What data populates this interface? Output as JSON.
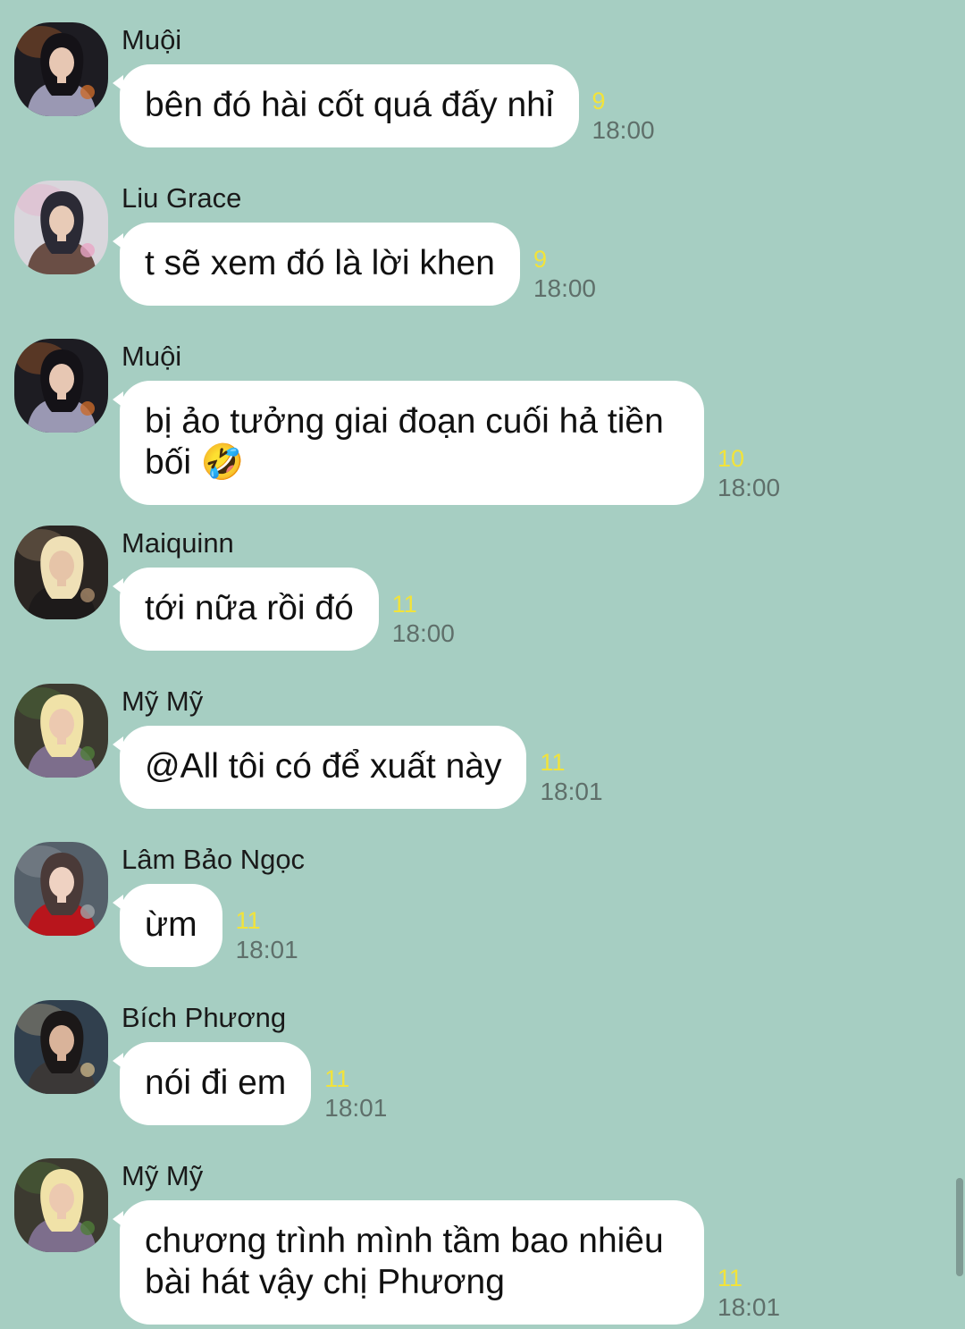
{
  "messages": [
    {
      "sender": "Muội",
      "text": "bên đó hài cốt quá đấy nhỉ",
      "read_count": "9",
      "time": "18:00",
      "avatar": {
        "icon": "avatar-muoii",
        "bg": "#1d1c22",
        "skin": "#e7c7b3",
        "hair": "#141217",
        "cloth": "#9a98b3",
        "accent": "#c96a2b"
      }
    },
    {
      "sender": "Liu Grace",
      "text": "t sẽ xem đó là lời khen",
      "read_count": "9",
      "time": "18:00",
      "avatar": {
        "icon": "avatar-liu-grace",
        "bg": "#d9d6dc",
        "skin": "#e8cbb7",
        "hair": "#2b2a35",
        "cloth": "#6a4e45",
        "accent": "#e8a6c5"
      }
    },
    {
      "sender": "Muội",
      "text": "bị ảo tưởng giai đoạn cuối hả tiền bối 🤣",
      "read_count": "10",
      "time": "18:00",
      "avatar": {
        "icon": "avatar-muoii",
        "bg": "#1d1c22",
        "skin": "#e7c7b3",
        "hair": "#141217",
        "cloth": "#9a98b3",
        "accent": "#c96a2b"
      }
    },
    {
      "sender": "Maiquinn",
      "text": "tới nữa rồi đó",
      "read_count": "11",
      "time": "18:00",
      "avatar": {
        "icon": "avatar-maiquinn",
        "bg": "#2a2522",
        "skin": "#e6c4a8",
        "hair": "#efe0b6",
        "cloth": "#1d1a1a",
        "accent": "#a78a6a"
      }
    },
    {
      "sender": "Mỹ Mỹ",
      "text": "@All tôi có để xuất này",
      "read_count": "11",
      "time": "18:01",
      "avatar": {
        "icon": "avatar-my-my",
        "bg": "#3c3a30",
        "skin": "#ecc9b0",
        "hair": "#f0e2a8",
        "cloth": "#7d6e8c",
        "accent": "#4f7d3a"
      }
    },
    {
      "sender": "Lâm Bảo Ngọc",
      "text": "ừm",
      "read_count": "11",
      "time": "18:01",
      "avatar": {
        "icon": "avatar-lam-bao-ngoc",
        "bg": "#55606a",
        "skin": "#efd2c2",
        "hair": "#4a3a38",
        "cloth": "#b8151c",
        "accent": "#9da4a8"
      }
    },
    {
      "sender": "Bích Phương",
      "text": "nói đi em",
      "read_count": "11",
      "time": "18:01",
      "avatar": {
        "icon": "avatar-bich-phuong",
        "bg": "#31404e",
        "skin": "#d9b39a",
        "hair": "#1b1818",
        "cloth": "#3b3837",
        "accent": "#c6b086"
      }
    },
    {
      "sender": "Mỹ Mỹ",
      "text": "chương trình mình tầm bao nhiêu bài hát vậy chị Phương",
      "read_count": "11",
      "time": "18:01",
      "avatar": {
        "icon": "avatar-my-my",
        "bg": "#3c3a30",
        "skin": "#ecc9b0",
        "hair": "#f0e2a8",
        "cloth": "#7d6e8c",
        "accent": "#4f7d3a"
      }
    }
  ]
}
